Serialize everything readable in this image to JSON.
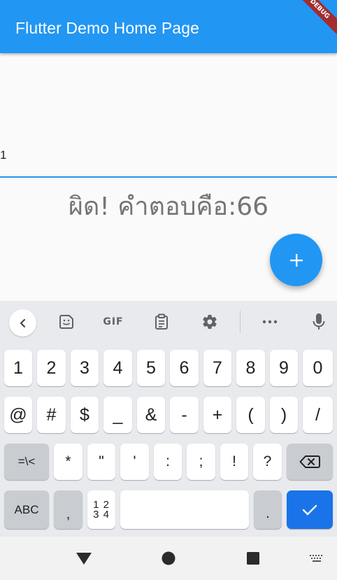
{
  "app_bar": {
    "title": "Flutter Demo Home Page",
    "debug_banner": "DEBUG",
    "color": "#2196f3"
  },
  "content": {
    "text_field_value": "1",
    "result_text": "ผิด! คำตอบคือ:66"
  },
  "fab": {
    "icon": "plus-icon",
    "color": "#2196f3"
  },
  "keyboard": {
    "toolbar": {
      "items": [
        "back-icon",
        "sticker-icon",
        "gif-icon",
        "clipboard-icon",
        "settings-icon",
        "more-icon",
        "mic-icon"
      ],
      "gif_label": "GIF"
    },
    "row1": [
      "1",
      "2",
      "3",
      "4",
      "5",
      "6",
      "7",
      "8",
      "9",
      "0"
    ],
    "row2": [
      "@",
      "#",
      "$",
      "_",
      "&",
      "-",
      "+",
      "(",
      ")",
      "/"
    ],
    "row3": {
      "shift_label": "=\\<",
      "keys": [
        "*",
        "\"",
        "'",
        ":",
        ";",
        "!",
        "?"
      ],
      "backspace_icon": "backspace-icon"
    },
    "row4": {
      "abc_label": "ABC",
      "comma": ",",
      "num_layout_top": "1 2",
      "num_layout_bottom": "3 4",
      "period": ".",
      "enter_icon": "check-icon",
      "enter_color": "#1a73e8"
    }
  },
  "navbar": {
    "items": [
      "back-triangle-icon",
      "home-circle-icon",
      "recents-square-icon",
      "keyboard-switch-icon"
    ]
  }
}
